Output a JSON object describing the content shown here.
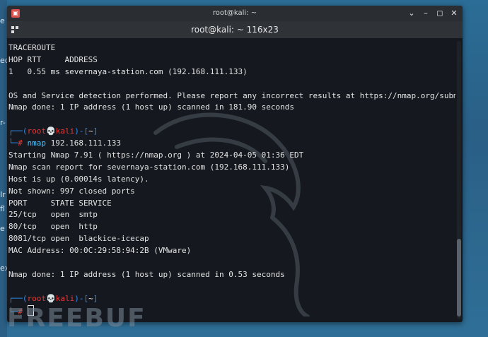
{
  "desktop": {
    "left_glyphs": [
      "e",
      "ed",
      "r-",
      "Ir",
      "fl",
      "e",
      "ex"
    ]
  },
  "window": {
    "titlebar_text": "root@kali: ~",
    "tab_title": "root@kali: ~ 116x23",
    "controls": [
      "⌄",
      "–",
      "◻",
      "✕"
    ]
  },
  "terminal": {
    "lines": [
      {
        "type": "text",
        "text": "TRACEROUTE"
      },
      {
        "type": "text",
        "text": "HOP RTT     ADDRESS"
      },
      {
        "type": "text",
        "text": "1   0.55 ms severnaya-station.com (192.168.111.133)"
      },
      {
        "type": "text",
        "text": ""
      },
      {
        "type": "text",
        "text": "OS and Service detection performed. Please report any incorrect results at https://nmap.org/submit/ ."
      },
      {
        "type": "text",
        "text": "Nmap done: 1 IP address (1 host up) scanned in 181.90 seconds"
      },
      {
        "type": "text",
        "text": ""
      },
      {
        "type": "prompt_top",
        "box1": "┌──(",
        "user": "root",
        "skull": "💀",
        "host": "kali",
        "box2": ")-[",
        "path": "~",
        "box3": "]"
      },
      {
        "type": "prompt_cmd",
        "box": "└─",
        "hash": "#",
        "cmd": " nmap",
        "args": " 192.168.111.133"
      },
      {
        "type": "text",
        "text": "Starting Nmap 7.91 ( https://nmap.org ) at 2024-04-05 01:36 EDT"
      },
      {
        "type": "text",
        "text": "Nmap scan report for severnaya-station.com (192.168.111.133)"
      },
      {
        "type": "text",
        "text": "Host is up (0.00014s latency)."
      },
      {
        "type": "text",
        "text": "Not shown: 997 closed ports"
      },
      {
        "type": "text",
        "text": "PORT     STATE SERVICE"
      },
      {
        "type": "text",
        "text": "25/tcp   open  smtp"
      },
      {
        "type": "text",
        "text": "80/tcp   open  http"
      },
      {
        "type": "text",
        "text": "8081/tcp open  blackice-icecap"
      },
      {
        "type": "text",
        "text": "MAC Address: 00:0C:29:58:94:2B (VMware)"
      },
      {
        "type": "text",
        "text": ""
      },
      {
        "type": "text",
        "text": "Nmap done: 1 IP address (1 host up) scanned in 0.53 seconds"
      },
      {
        "type": "text",
        "text": ""
      },
      {
        "type": "prompt_top",
        "box1": "┌──(",
        "user": "root",
        "skull": "💀",
        "host": "kali",
        "box2": ")-[",
        "path": "~",
        "box3": "]"
      },
      {
        "type": "prompt_cursor",
        "box": "└─",
        "hash": "#"
      }
    ]
  },
  "watermark": "FREEBUF",
  "colors": {
    "terminal_bg": "#15191f",
    "prompt_blue": "#2f8df0",
    "prompt_red": "#e03b3b",
    "cmd_cyan": "#4fc1ff"
  }
}
